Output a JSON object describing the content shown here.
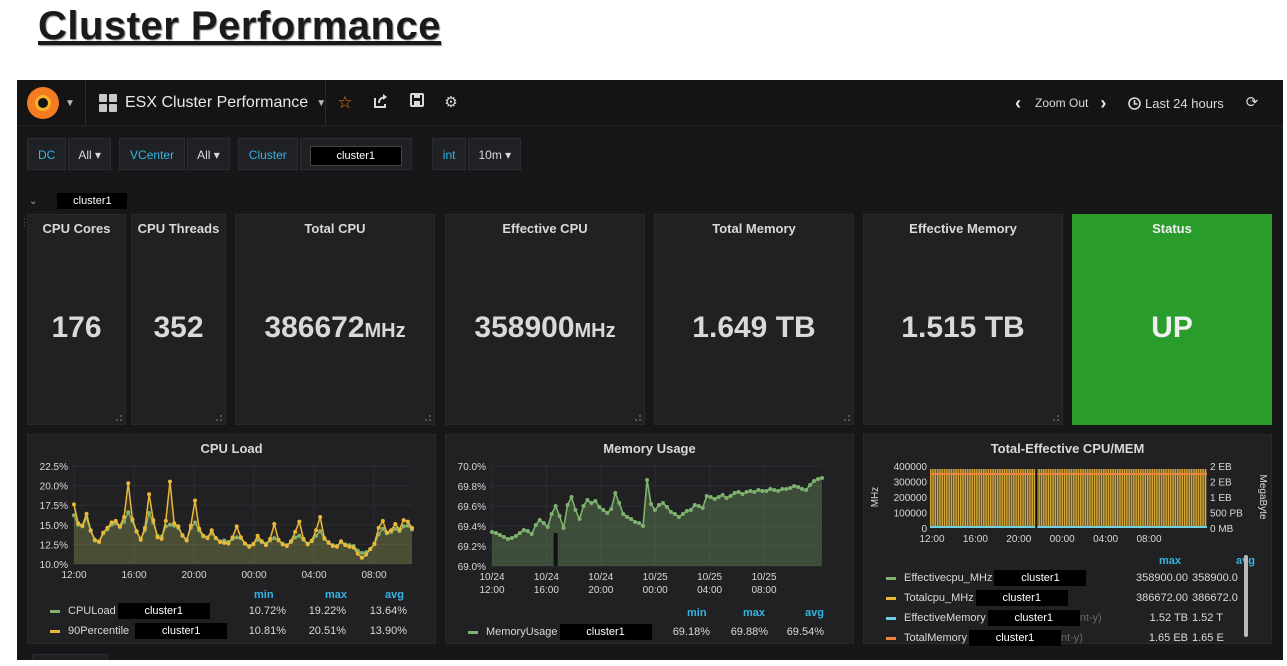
{
  "slide": {
    "title": "Cluster Performance"
  },
  "navbar": {
    "dashboard_title": "ESX Cluster Performance",
    "zoom_out": "Zoom Out",
    "time_range": "Last 24 hours"
  },
  "variables": [
    {
      "label": "DC",
      "value": "All"
    },
    {
      "label": "VCenter",
      "value": "All"
    },
    {
      "label": "Cluster",
      "value": "cluster1"
    },
    {
      "label": "int",
      "value": "10m"
    }
  ],
  "row": {
    "title": "cluster1"
  },
  "stats": {
    "cpu_cores": {
      "title": "CPU Cores",
      "value": "176",
      "unit": ""
    },
    "cpu_threads": {
      "title": "CPU Threads",
      "value": "352",
      "unit": ""
    },
    "total_cpu": {
      "title": "Total CPU",
      "value": "386672",
      "unit": "MHz"
    },
    "effective_cpu": {
      "title": "Effective CPU",
      "value": "358900",
      "unit": "MHz"
    },
    "total_memory": {
      "title": "Total Memory",
      "value": "1.649 TB",
      "unit": ""
    },
    "effective_memory": {
      "title": "Effective Memory",
      "value": "1.515 TB",
      "unit": ""
    },
    "status": {
      "title": "Status",
      "value": "UP",
      "color": "#299c2c"
    }
  },
  "colors": {
    "green_series": "#7eb26d",
    "yellow_series": "#eab839",
    "blue_series": "#6ed0e0",
    "orange_series": "#ef843c",
    "legend_header": "#33b5e5"
  },
  "chart_data": [
    {
      "type": "line",
      "title": "CPU Load",
      "y_ticks": [
        "22.5%",
        "20.0%",
        "17.5%",
        "15.0%",
        "12.5%",
        "10.0%"
      ],
      "x_ticks": [
        "12:00",
        "16:00",
        "20:00",
        "00:00",
        "04:00",
        "08:00"
      ],
      "ylim": [
        10.0,
        22.5
      ],
      "legend_headers": [
        "min",
        "max",
        "avg"
      ],
      "series": [
        {
          "name": "CPULoad",
          "tag": "cluster1",
          "color": "#7eb26d",
          "min": "10.72%",
          "max": "19.22%",
          "avg": "13.64%",
          "values": [
            16.2,
            15.0,
            14.8,
            15.9,
            14.2,
            13.0,
            12.9,
            13.9,
            14.4,
            15.0,
            15.2,
            14.7,
            15.4,
            16.6,
            15.5,
            14.1,
            13.2,
            14.3,
            16.5,
            15.3,
            13.6,
            13.5,
            14.8,
            15.0,
            14.9,
            14.6,
            13.7,
            13.1,
            14.6,
            15.3,
            14.3,
            13.5,
            13.4,
            13.9,
            13.3,
            12.9,
            13.0,
            12.8,
            13.2,
            13.4,
            13.3,
            12.6,
            12.3,
            12.6,
            13.1,
            12.8,
            12.6,
            13.0,
            13.3,
            13.0,
            12.6,
            12.4,
            12.8,
            13.4,
            13.6,
            13.1,
            12.6,
            12.9,
            13.6,
            14.2,
            13.2,
            12.8,
            12.4,
            12.3,
            12.8,
            12.5,
            12.4,
            12.3,
            11.7,
            11.4,
            11.5,
            11.9,
            12.5,
            13.8,
            14.5,
            13.9,
            14.1,
            14.5,
            14.2,
            14.8,
            14.9,
            14.4
          ]
        },
        {
          "name": "90Percentile",
          "tag": "cluster1",
          "color": "#eab839",
          "min": "10.81%",
          "max": "20.51%",
          "avg": "13.90%",
          "values": [
            17.6,
            15.2,
            14.9,
            16.4,
            14.3,
            13.1,
            12.8,
            14.0,
            14.6,
            15.3,
            15.5,
            14.8,
            16.0,
            20.3,
            15.7,
            14.2,
            13.1,
            14.6,
            18.9,
            15.6,
            13.4,
            13.2,
            15.5,
            20.5,
            15.2,
            14.8,
            13.6,
            13.0,
            14.9,
            18.1,
            14.5,
            13.6,
            13.3,
            14.3,
            13.3,
            12.8,
            12.7,
            12.6,
            13.4,
            14.8,
            13.4,
            12.6,
            12.2,
            12.5,
            13.6,
            12.9,
            12.4,
            13.2,
            15.1,
            13.1,
            12.5,
            12.3,
            12.9,
            14.1,
            15.4,
            13.2,
            12.5,
            13.0,
            14.3,
            16.0,
            13.3,
            12.7,
            12.3,
            12.2,
            12.9,
            12.4,
            12.2,
            12.1,
            11.3,
            10.8,
            11.2,
            11.9,
            12.6,
            14.6,
            15.5,
            14.0,
            14.3,
            15.1,
            14.4,
            15.6,
            15.4,
            14.6
          ]
        }
      ]
    },
    {
      "type": "area",
      "title": "Memory Usage",
      "y_ticks": [
        "70.0%",
        "69.8%",
        "69.6%",
        "69.4%",
        "69.2%",
        "69.0%"
      ],
      "x_ticks": [
        "10/24\n12:00",
        "10/24\n16:00",
        "10/24\n20:00",
        "10/25\n00:00",
        "10/25\n04:00",
        "10/25\n08:00"
      ],
      "ylim": [
        69.0,
        70.0
      ],
      "legend_headers": [
        "min",
        "max",
        "avg"
      ],
      "series": [
        {
          "name": "MemoryUsage",
          "tag": "cluster1",
          "color": "#7eb26d",
          "min": "69.18%",
          "max": "69.88%",
          "avg": "69.54%",
          "values": [
            69.34,
            69.33,
            69.31,
            69.29,
            69.27,
            69.28,
            69.3,
            69.33,
            69.36,
            69.35,
            69.32,
            69.41,
            69.46,
            69.43,
            69.39,
            69.52,
            69.6,
            69.5,
            69.38,
            69.61,
            69.69,
            69.56,
            69.47,
            69.6,
            69.66,
            69.63,
            69.65,
            69.59,
            69.56,
            69.53,
            69.57,
            69.73,
            69.63,
            69.52,
            69.49,
            69.47,
            69.44,
            69.43,
            69.4,
            69.86,
            69.62,
            69.56,
            69.61,
            69.63,
            69.59,
            69.54,
            69.52,
            69.49,
            69.52,
            69.55,
            69.56,
            69.61,
            69.6,
            69.58,
            69.7,
            69.69,
            69.67,
            69.69,
            69.71,
            69.68,
            69.7,
            69.73,
            69.74,
            69.72,
            69.74,
            69.75,
            69.74,
            69.76,
            69.75,
            69.75,
            69.77,
            69.76,
            69.75,
            69.77,
            69.77,
            69.78,
            69.8,
            69.79,
            69.77,
            69.76,
            69.81,
            69.85,
            69.87,
            69.88
          ]
        }
      ]
    },
    {
      "type": "bar",
      "title": "Total-Effective CPU/MEM",
      "y_left_label": "MHz",
      "y_left_ticks": [
        "400000",
        "300000",
        "200000",
        "100000",
        "0"
      ],
      "y_right_label": "MegaByte",
      "y_right_ticks": [
        "2 EB",
        "2 EB",
        "1 EB",
        "500 PB",
        "0 MB"
      ],
      "x_ticks": [
        "12:00",
        "16:00",
        "20:00",
        "00:00",
        "04:00",
        "08:00"
      ],
      "legend_headers": [
        "max",
        "avg"
      ],
      "series": [
        {
          "name": "Effectivecpu_MHz",
          "tag": "cluster1",
          "color": "#7eb26d",
          "max": "358900.00",
          "avg": "358900.0"
        },
        {
          "name": "Totalcpu_MHz",
          "tag": "cluster1",
          "color": "#eab839",
          "max": "386672.00",
          "avg": "386672.0"
        },
        {
          "name": "EffectiveMemory",
          "tag": "cluster1",
          "suffix": "nt-y)",
          "color": "#6ed0e0",
          "max": "1.52 TB",
          "avg": "1.52 T"
        },
        {
          "name": "TotalMemory",
          "tag": "cluster1",
          "suffix": "nt-y)",
          "color": "#ef843c",
          "max": "1.65 EB",
          "avg": "1.65 E"
        }
      ]
    }
  ]
}
